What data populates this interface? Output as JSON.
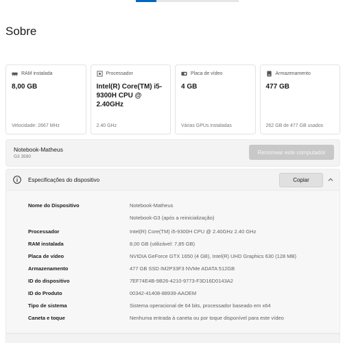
{
  "page": {
    "title": "Sobre"
  },
  "cards": [
    {
      "label": "RAM instalada",
      "value": "8,00 GB",
      "sub": "Velocidade: 2667 MHz",
      "icon": "ram-icon"
    },
    {
      "label": "Processador",
      "value": "Intel(R) Core(TM) i5-9300H CPU @ 2.40GHz",
      "sub": "2.40 GHz",
      "icon": "processor-icon"
    },
    {
      "label": "Placa de vídeo",
      "value": "4 GB",
      "sub": "Várias GPUs instaladas",
      "icon": "gpu-icon"
    },
    {
      "label": "Armazenamento",
      "value": "477 GB",
      "sub": "262 GB de 477 GB usados",
      "icon": "storage-icon"
    }
  ],
  "computer": {
    "name": "Notebook-Matheus",
    "model": "G3 3590",
    "rename_label": "Renomear este computador"
  },
  "specs": {
    "title": "Especificações do dispositivo",
    "copy_label": "Copiar",
    "rows": [
      {
        "key": "Nome do Dispositivo",
        "value": "Notebook-Matheus"
      },
      {
        "key": "",
        "value": "Notebook-G3 (após a reinicialização)"
      },
      {
        "key": "Processador",
        "value": "Intel(R) Core(TM) i5-9300H CPU @ 2.40GHz   2.40 GHz"
      },
      {
        "key": "RAM instalada",
        "value": "8,00 GB (utilizável: 7,85 GB)"
      },
      {
        "key": "Placa de vídeo",
        "value": "NVIDIA GeForce GTX 1650 (4 GB), Intel(R) UHD Graphics 630 (128 MB)"
      },
      {
        "key": "Armazenamento",
        "value": "477 GB SSD IM2P33F3 NVMe ADATA 512GB"
      },
      {
        "key": "ID do dispositivo",
        "value": "7EF74E4B-9B26-4210-9773-F3D16D0143A2"
      },
      {
        "key": "ID do Produto",
        "value": "00342-41408-88939-AAOEM"
      },
      {
        "key": "Tipo de sistema",
        "value": "Sistema operacional de 64 bits, processador baseado em x64"
      },
      {
        "key": "Caneta e toque",
        "value": "Nenhuma entrada à caneta ou por toque disponível para este vídeo"
      }
    ]
  },
  "colors": {
    "accent": "#0067c0",
    "panel": "#f3f3f3",
    "muted_text": "#5f5f5f"
  }
}
